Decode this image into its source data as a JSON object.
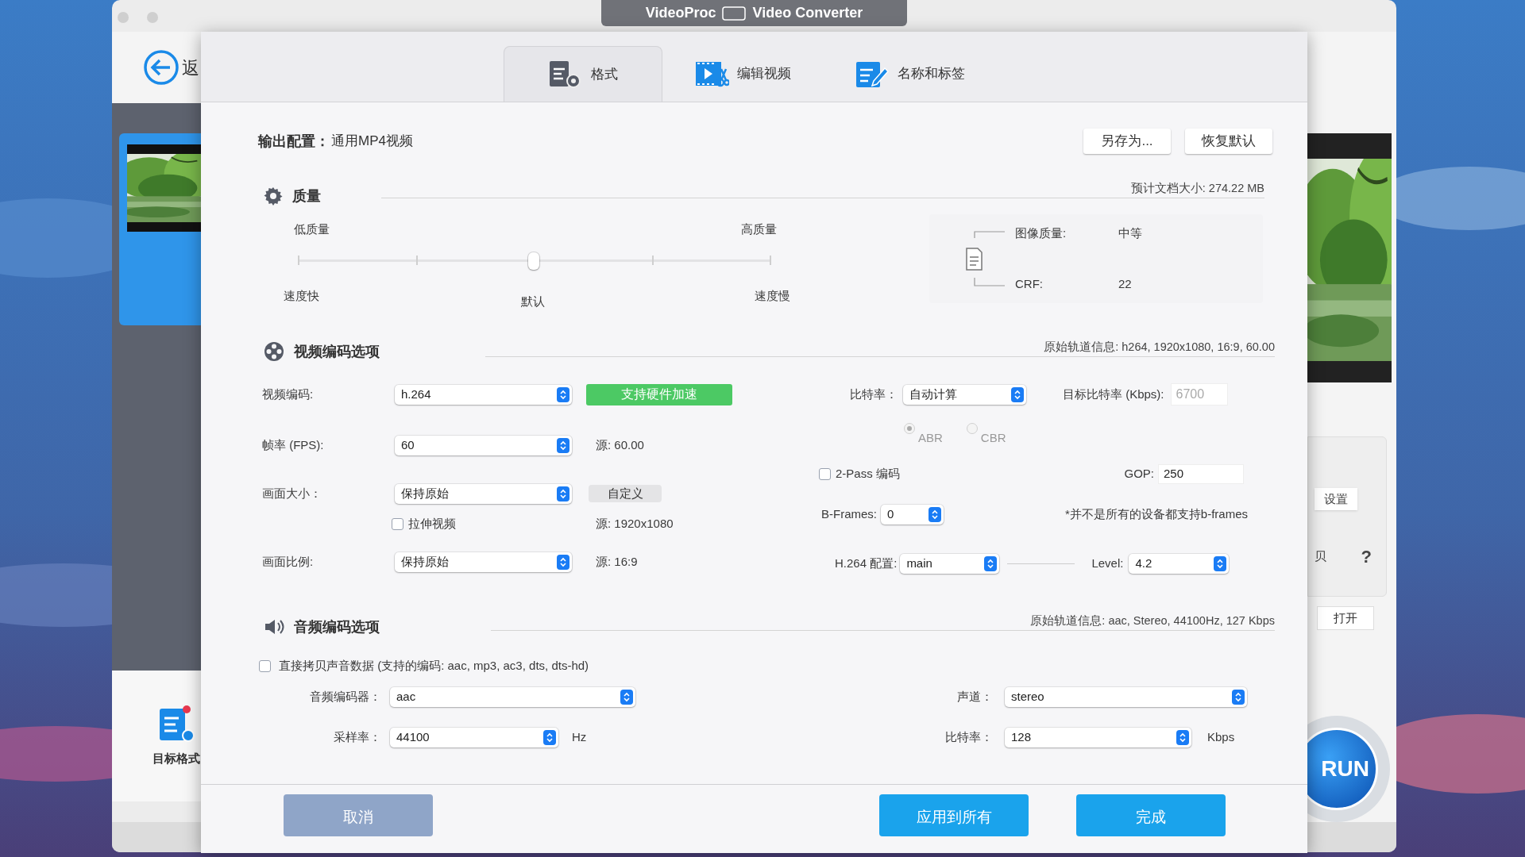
{
  "window": {
    "title": "VideoProc",
    "title_suffix": "Video Converter"
  },
  "background_app": {
    "back_label": "返",
    "settings_button": "设置",
    "copy_label": "贝",
    "help_label": "?",
    "open_button": "打开",
    "run_button": "RUN",
    "target_format_label": "目标格式"
  },
  "tabs": [
    {
      "label": "格式",
      "selected": true,
      "kind": "format"
    },
    {
      "label": "编辑视频",
      "selected": false,
      "kind": "edit"
    },
    {
      "label": "名称和标签",
      "selected": false,
      "kind": "tag"
    }
  ],
  "output_profile": {
    "label": "输出配置：",
    "value": "通用MP4视频"
  },
  "profile_buttons": [
    "另存为...",
    "恢复默认"
  ],
  "quality": {
    "title": "质量",
    "estimated_size": "预计文档大小: 274.22 MB",
    "low_label": "低质量",
    "high_label": "高质量",
    "fast_label": "速度快",
    "default_label": "默认",
    "slow_label": "速度慢",
    "level": 0.5,
    "image_quality_label": "图像质量:",
    "image_quality_value": "中等",
    "crf_label": "CRF:",
    "crf_value": "22"
  },
  "video_options": {
    "title": "视频编码选项",
    "source_info": "原始轨道信息: h264, 1920x1080, 16:9, 60.00",
    "codec": {
      "label": "视频编码:",
      "value": "h.264"
    },
    "hw_accel_badge": "支持硬件加速",
    "fps": {
      "label": "帧率 (FPS):",
      "value": "60",
      "source": "源: 60.00"
    },
    "resolution": {
      "label": "画面大小：",
      "value": "保持原始",
      "custom_button": "自定义",
      "source": "源: 1920x1080"
    },
    "stretch": {
      "label": "拉伸视频",
      "checked": false
    },
    "aspect": {
      "label": "画面比例:",
      "value": "保持原始",
      "source": "源: 16:9"
    },
    "bitrate": {
      "label": "比特率：",
      "value": "自动计算"
    },
    "target_bitrate": {
      "label": "目标比特率 (Kbps):",
      "value": "6700",
      "disabled": true
    },
    "rate_modes": [
      {
        "label": "ABR",
        "selected": true,
        "disabled": true
      },
      {
        "label": "CBR",
        "selected": false,
        "disabled": true
      }
    ],
    "two_pass": {
      "label": "2-Pass 编码",
      "checked": false
    },
    "gop": {
      "label": "GOP:",
      "value": "250"
    },
    "b_frames": {
      "label": "B-Frames:",
      "value": "0",
      "note": "*并不是所有的设备都支持b-frames"
    },
    "profile": {
      "label": "H.264 配置:",
      "value": "main"
    },
    "level": {
      "label": "Level:",
      "value": "4.2"
    }
  },
  "audio_options": {
    "title": "音频编码选项",
    "source_info": "原始轨道信息: aac, Stereo, 44100Hz, 127 Kbps",
    "copy_audio": {
      "label": "直接拷贝声音数据 (支持的编码: aac, mp3, ac3, dts, dts-hd)",
      "checked": false
    },
    "encoder": {
      "label": "音频编码器：",
      "value": "aac"
    },
    "channel": {
      "label": "声道：",
      "value": "stereo"
    },
    "sample_rate": {
      "label": "采样率：",
      "value": "44100",
      "unit": "Hz"
    },
    "bitrate": {
      "label": "比特率：",
      "value": "128",
      "unit": "Kbps"
    }
  },
  "footer_buttons": [
    {
      "label": "取消",
      "kind": "secondary"
    },
    {
      "label": "应用到所有",
      "kind": "primary"
    },
    {
      "label": "完成",
      "kind": "primary"
    }
  ]
}
